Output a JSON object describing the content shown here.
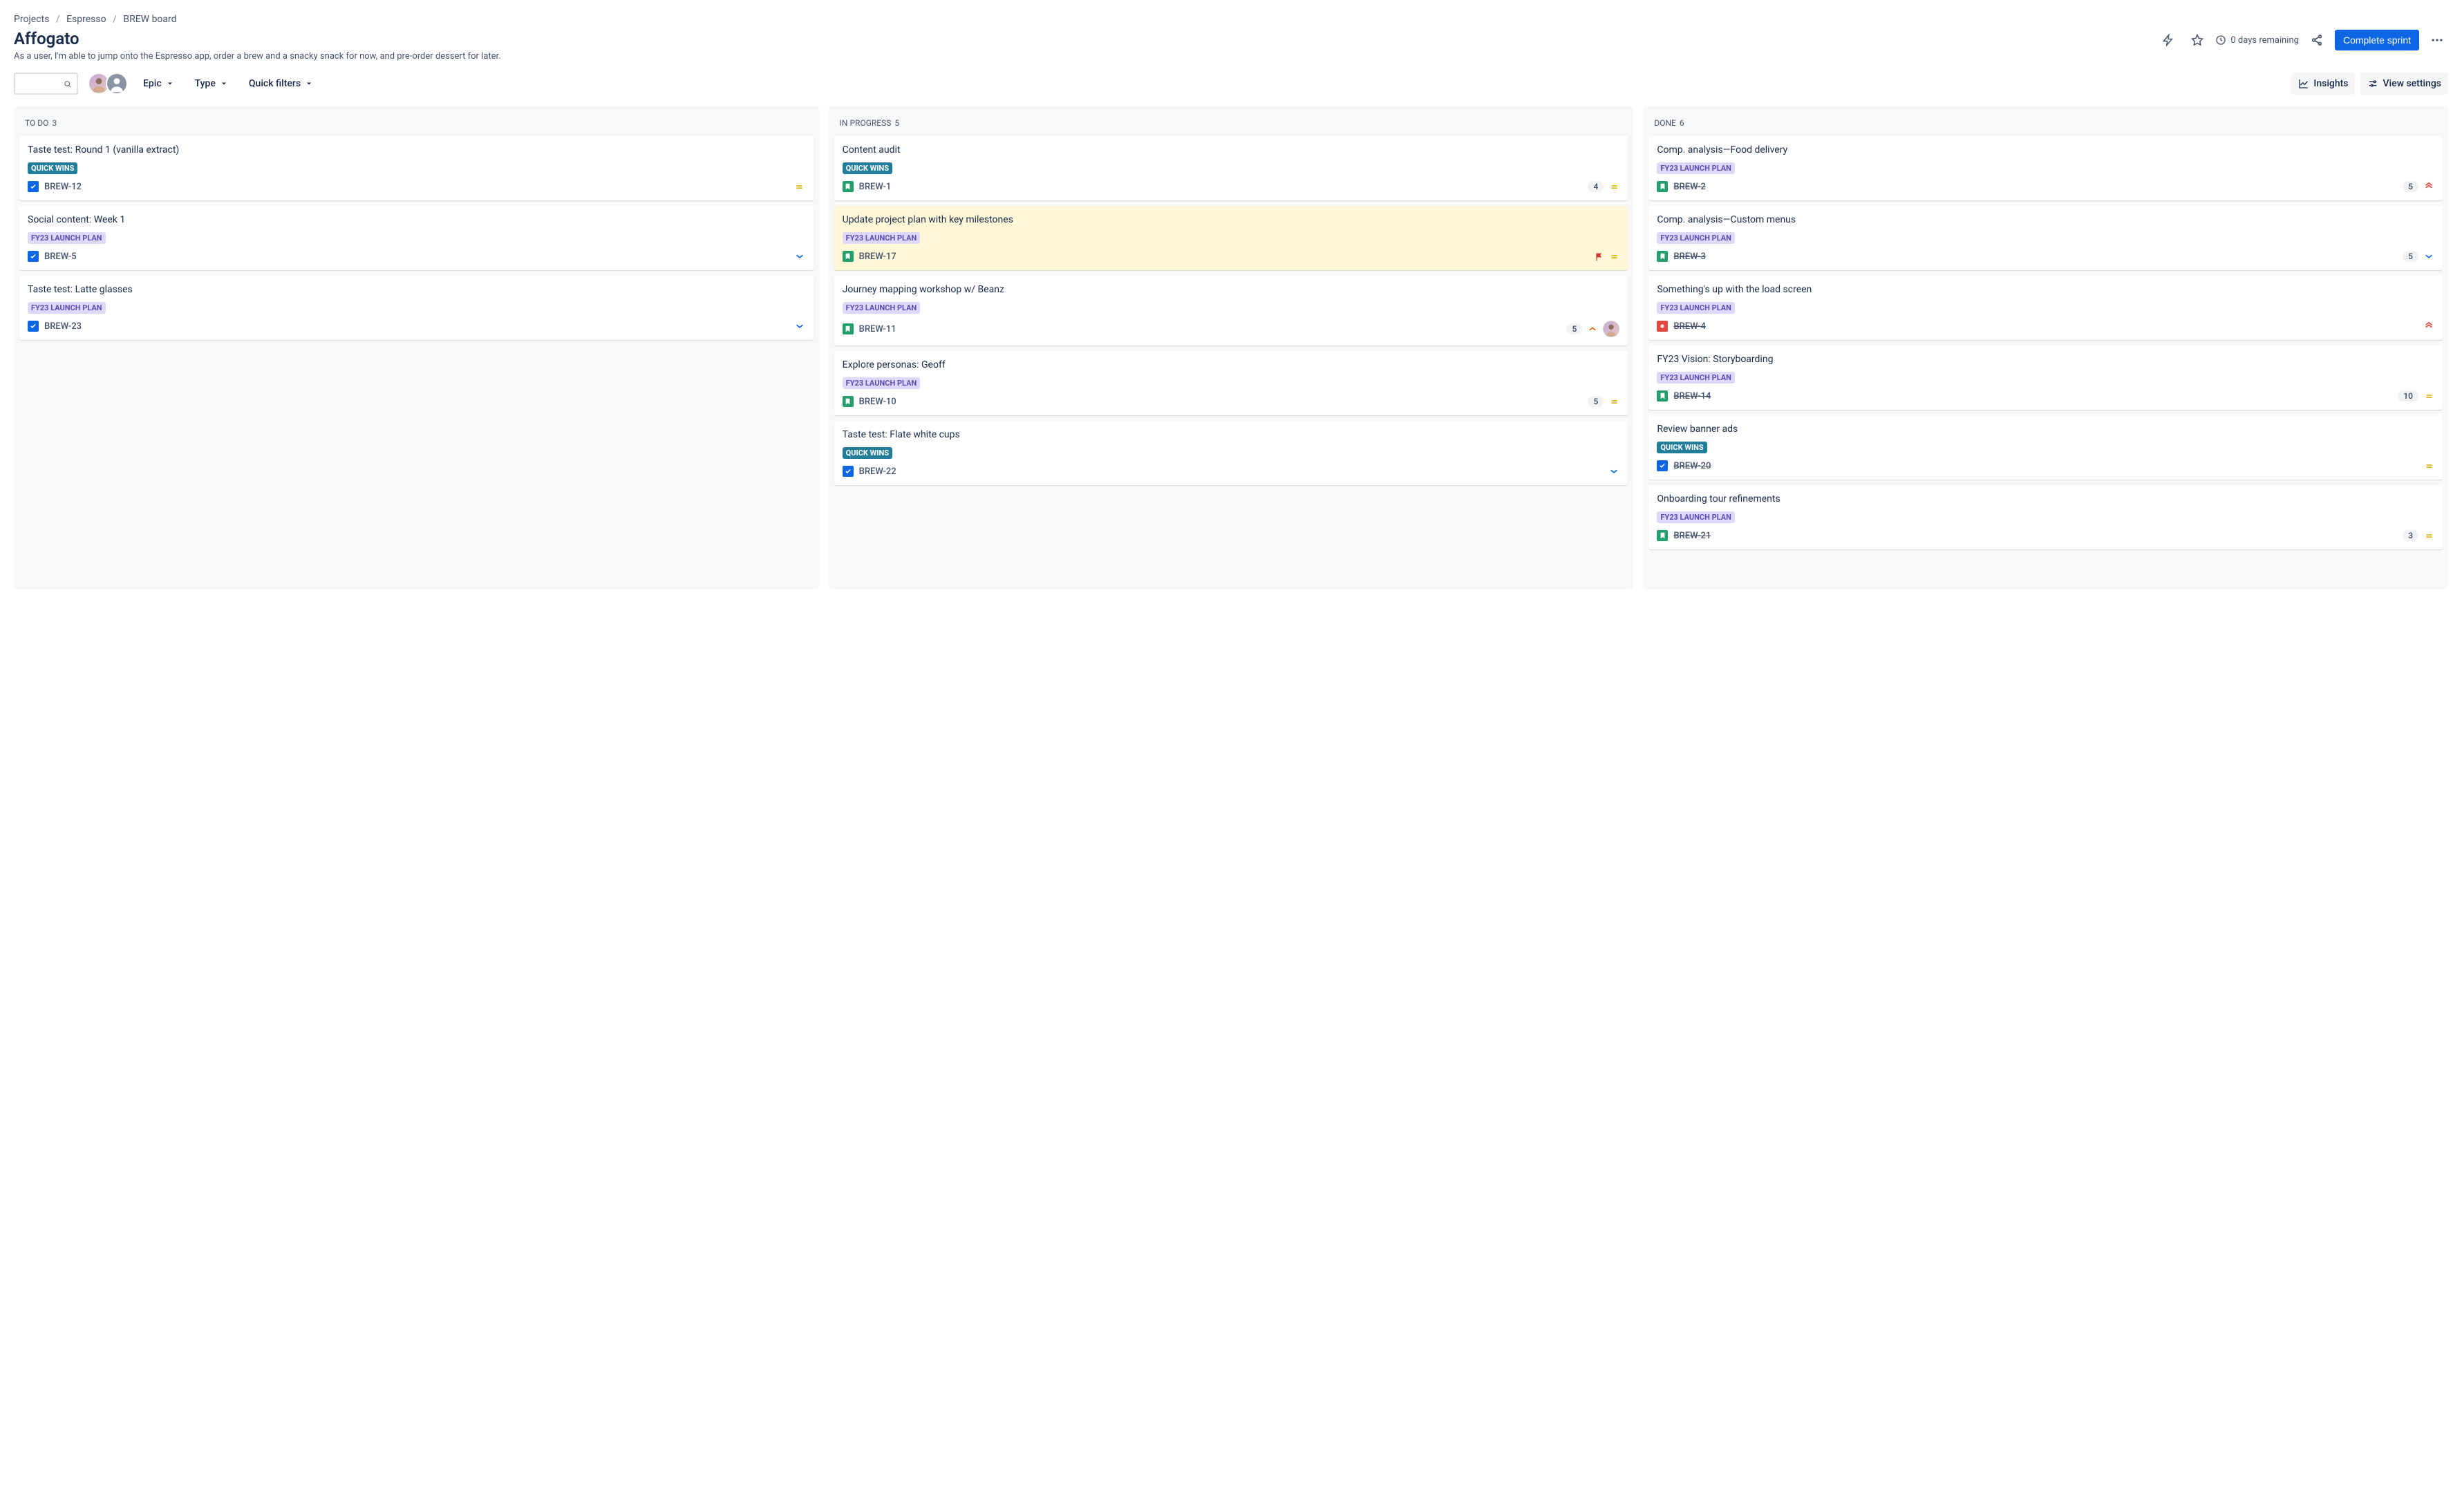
{
  "breadcrumb": {
    "root": "Projects",
    "project": "Espresso",
    "board": "BREW board"
  },
  "title": "Affogato",
  "subtitle": "As a user, I'm able to jump onto the Espresso app, order a brew and a snacky snack for now, and pre-order dessert for later.",
  "header_actions": {
    "time_remaining": "0 days remaining",
    "complete_sprint": "Complete sprint"
  },
  "filters": {
    "epic": "Epic",
    "type": "Type",
    "quick": "Quick filters"
  },
  "toolbar_right": {
    "insights": "Insights",
    "view_settings": "View settings"
  },
  "labels": {
    "quick_wins": "QUICK WINS",
    "fy23": "FY23 LAUNCH PLAN"
  },
  "columns": [
    {
      "name": "To Do",
      "count": 3
    },
    {
      "name": "In Progress",
      "count": 5
    },
    {
      "name": "Done",
      "count": 6
    }
  ],
  "cards": {
    "todo": [
      {
        "title": "Taste test: Round 1 (vanilla extract)",
        "label": "quick_wins",
        "type": "task",
        "key": "BREW-12",
        "priority": "medium"
      },
      {
        "title": "Social content: Week 1",
        "label": "fy23",
        "type": "task",
        "key": "BREW-5",
        "priority": "low"
      },
      {
        "title": "Taste test: Latte glasses",
        "label": "fy23",
        "type": "task",
        "key": "BREW-23",
        "priority": "low"
      }
    ],
    "inprogress": [
      {
        "title": "Content audit",
        "label": "quick_wins",
        "type": "story",
        "key": "BREW-1",
        "estimate": "4",
        "priority": "medium"
      },
      {
        "title": "Update project plan with key milestones",
        "label": "fy23",
        "type": "story",
        "key": "BREW-17",
        "flagged": true,
        "flag": true,
        "priority": "medium"
      },
      {
        "title": "Journey mapping workshop w/ Beanz",
        "label": "fy23",
        "type": "story",
        "key": "BREW-11",
        "estimate": "5",
        "priority": "high",
        "assignee": true
      },
      {
        "title": "Explore personas: Geoff",
        "label": "fy23",
        "type": "story",
        "key": "BREW-10",
        "estimate": "5",
        "priority": "medium"
      },
      {
        "title": "Taste test: Flate white cups",
        "label": "quick_wins",
        "type": "task",
        "key": "BREW-22",
        "priority": "low"
      }
    ],
    "done": [
      {
        "title": "Comp. analysis—Food delivery",
        "label": "fy23",
        "type": "story",
        "key": "BREW-2",
        "done": true,
        "estimate": "5",
        "priority": "highest"
      },
      {
        "title": "Comp. analysis—Custom menus",
        "label": "fy23",
        "type": "story",
        "key": "BREW-3",
        "done": true,
        "estimate": "5",
        "priority": "low"
      },
      {
        "title": "Something's up with the load screen",
        "label": "fy23",
        "type": "bug",
        "key": "BREW-4",
        "done": true,
        "priority": "highest"
      },
      {
        "title": "FY23 Vision: Storyboarding",
        "label": "fy23",
        "type": "story",
        "key": "BREW-14",
        "done": true,
        "estimate": "10",
        "priority": "medium"
      },
      {
        "title": "Review banner ads",
        "label": "quick_wins",
        "type": "task",
        "key": "BREW-20",
        "done": true,
        "priority": "medium"
      },
      {
        "title": "Onboarding tour refinements",
        "label": "fy23",
        "type": "story",
        "key": "BREW-21",
        "done": true,
        "estimate": "3",
        "priority": "medium"
      }
    ]
  }
}
